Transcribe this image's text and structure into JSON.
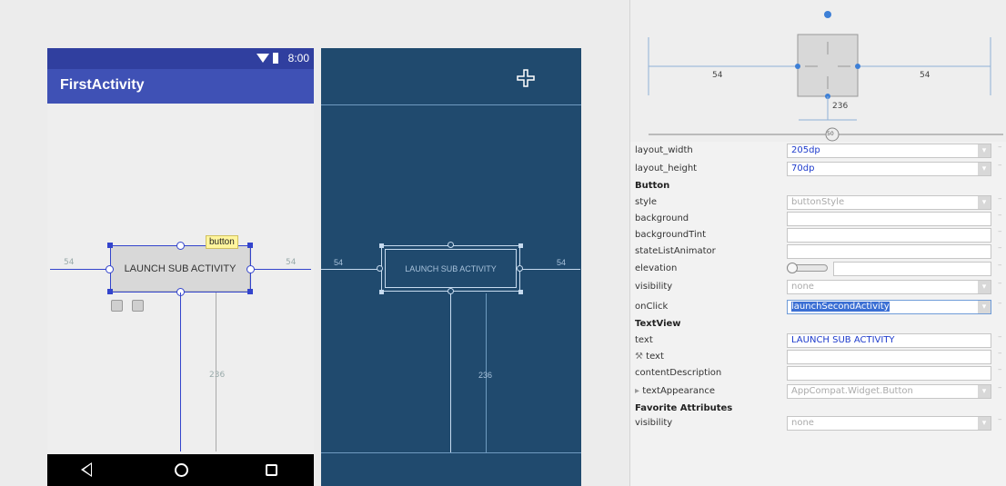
{
  "phone": {
    "time": "8:00",
    "app_title": "FirstActivity",
    "button_label": "LAUNCH SUB ACTIVITY",
    "tooltip": "button",
    "left_margin": "54",
    "right_margin": "54",
    "bottom_margin": "236"
  },
  "blueprint": {
    "button_label": "LAUNCH SUB ACTIVITY",
    "left_margin": "54",
    "right_margin": "54",
    "bottom_margin": "236"
  },
  "inspector": {
    "left_margin": "54",
    "right_margin": "54",
    "bottom_margin": "236",
    "bias": "50"
  },
  "attributes": {
    "rows": [
      {
        "name": "layout_width",
        "value": "205dp"
      },
      {
        "name": "layout_height",
        "value": "70dp"
      }
    ],
    "button_section": "Button",
    "button_rows": [
      {
        "name": "style",
        "value": "buttonStyle"
      },
      {
        "name": "background",
        "value": ""
      },
      {
        "name": "backgroundTint",
        "value": ""
      },
      {
        "name": "stateListAnimator",
        "value": ""
      },
      {
        "name": "elevation",
        "value": ""
      },
      {
        "name": "visibility",
        "value": "none"
      },
      {
        "name": "onClick",
        "value": "launchSecondActivity"
      }
    ],
    "textview_section": "TextView",
    "textview_rows": [
      {
        "name": "text",
        "value": "LAUNCH SUB ACTIVITY"
      },
      {
        "name": "text",
        "value": ""
      },
      {
        "name": "contentDescription",
        "value": ""
      },
      {
        "name": "textAppearance",
        "value": "AppCompat.Widget.Button"
      }
    ],
    "favorite_section": "Favorite Attributes",
    "favorite_rows": [
      {
        "name": "visibility",
        "value": "none"
      }
    ]
  },
  "colors": {
    "app_bar": "#3f51b5",
    "status_bar": "#303f9f",
    "blueprint_bg": "#204a6e",
    "selection": "#3344cc"
  }
}
